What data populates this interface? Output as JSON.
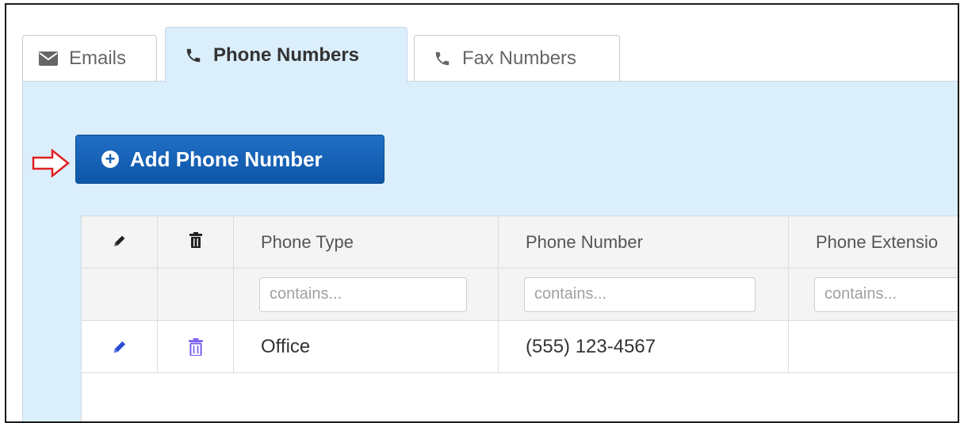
{
  "tabs": [
    {
      "label": "Emails",
      "icon": "envelope-icon",
      "active": false
    },
    {
      "label": "Phone Numbers",
      "icon": "phone-icon",
      "active": true
    },
    {
      "label": "Fax Numbers",
      "icon": "phone-icon",
      "active": false
    }
  ],
  "toolbar": {
    "add_label": "Add Phone Number",
    "add_icon": "plus-circle-icon"
  },
  "grid": {
    "columns": [
      {
        "label": "",
        "icon": "pencil-icon"
      },
      {
        "label": "",
        "icon": "trash-icon"
      },
      {
        "label": "Phone Type"
      },
      {
        "label": "Phone Number"
      },
      {
        "label": "Phone Extensio"
      }
    ],
    "filters": {
      "phone_type": {
        "value": "",
        "placeholder": "contains..."
      },
      "phone_number": {
        "value": "",
        "placeholder": "contains..."
      },
      "phone_extension": {
        "value": "",
        "placeholder": "contains..."
      }
    },
    "rows": [
      {
        "phone_type": "Office",
        "phone_number": "(555) 123-4567",
        "phone_extension": ""
      }
    ]
  },
  "colors": {
    "panel_bg": "#dbeefc",
    "button_bg": "#1460b5",
    "edit_icon": "#2a4fd6",
    "delete_icon": "#7a5cf0",
    "annotation_arrow": "#e02020"
  }
}
